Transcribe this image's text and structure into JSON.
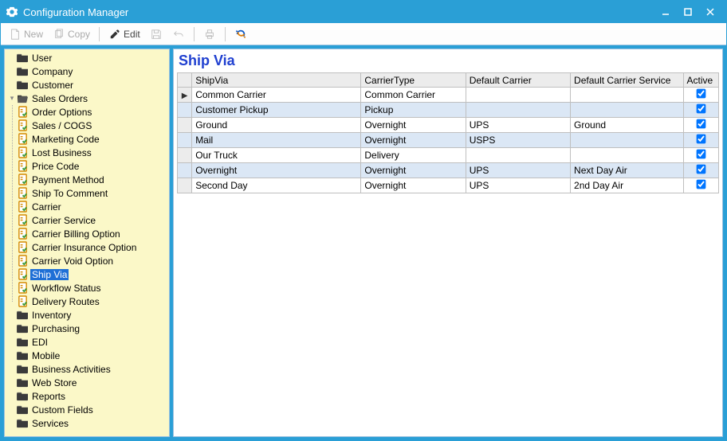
{
  "window": {
    "title": "Configuration Manager"
  },
  "toolbar": {
    "new": "New",
    "copy": "Copy",
    "edit": "Edit"
  },
  "tree": {
    "roots": [
      {
        "label": "User",
        "icon": "folder"
      },
      {
        "label": "Company",
        "icon": "folder"
      },
      {
        "label": "Customer",
        "icon": "folder"
      },
      {
        "label": "Sales Orders",
        "icon": "folder-open",
        "expanded": true,
        "children": [
          {
            "label": "Order Options"
          },
          {
            "label": "Sales / COGS"
          },
          {
            "label": "Marketing Code"
          },
          {
            "label": "Lost Business"
          },
          {
            "label": "Price Code"
          },
          {
            "label": "Payment Method"
          },
          {
            "label": "Ship To Comment"
          },
          {
            "label": "Carrier"
          },
          {
            "label": "Carrier Service"
          },
          {
            "label": "Carrier Billing Option"
          },
          {
            "label": "Carrier Insurance Option"
          },
          {
            "label": "Carrier Void Option"
          },
          {
            "label": "Ship Via",
            "selected": true
          },
          {
            "label": "Workflow Status"
          },
          {
            "label": "Delivery Routes"
          }
        ]
      },
      {
        "label": "Inventory",
        "icon": "folder"
      },
      {
        "label": "Purchasing",
        "icon": "folder"
      },
      {
        "label": "EDI",
        "icon": "folder"
      },
      {
        "label": "Mobile",
        "icon": "folder"
      },
      {
        "label": "Business Activities",
        "icon": "folder"
      },
      {
        "label": "Web Store",
        "icon": "folder"
      },
      {
        "label": "Reports",
        "icon": "folder"
      },
      {
        "label": "Custom Fields",
        "icon": "folder"
      },
      {
        "label": "Services",
        "icon": "folder"
      }
    ]
  },
  "content": {
    "title": "Ship Via",
    "columns": [
      "ShipVia",
      "CarrierType",
      "Default Carrier",
      "Default Carrier Service",
      "Active"
    ],
    "rows": [
      {
        "current": true,
        "shipvia": "Common Carrier",
        "carriertype": "Common Carrier",
        "defcarrier": "",
        "defservice": "",
        "active": true
      },
      {
        "shipvia": "Customer Pickup",
        "carriertype": "Pickup",
        "defcarrier": "",
        "defservice": "",
        "active": true
      },
      {
        "shipvia": "Ground",
        "carriertype": "Overnight",
        "defcarrier": "UPS",
        "defservice": "Ground",
        "active": true
      },
      {
        "shipvia": "Mail",
        "carriertype": "Overnight",
        "defcarrier": "USPS",
        "defservice": "",
        "active": true
      },
      {
        "shipvia": "Our Truck",
        "carriertype": "Delivery",
        "defcarrier": "",
        "defservice": "",
        "active": true
      },
      {
        "shipvia": "Overnight",
        "carriertype": "Overnight",
        "defcarrier": "UPS",
        "defservice": "Next Day Air",
        "active": true
      },
      {
        "shipvia": "Second Day",
        "carriertype": "Overnight",
        "defcarrier": "UPS",
        "defservice": "2nd Day Air",
        "active": true
      }
    ]
  }
}
